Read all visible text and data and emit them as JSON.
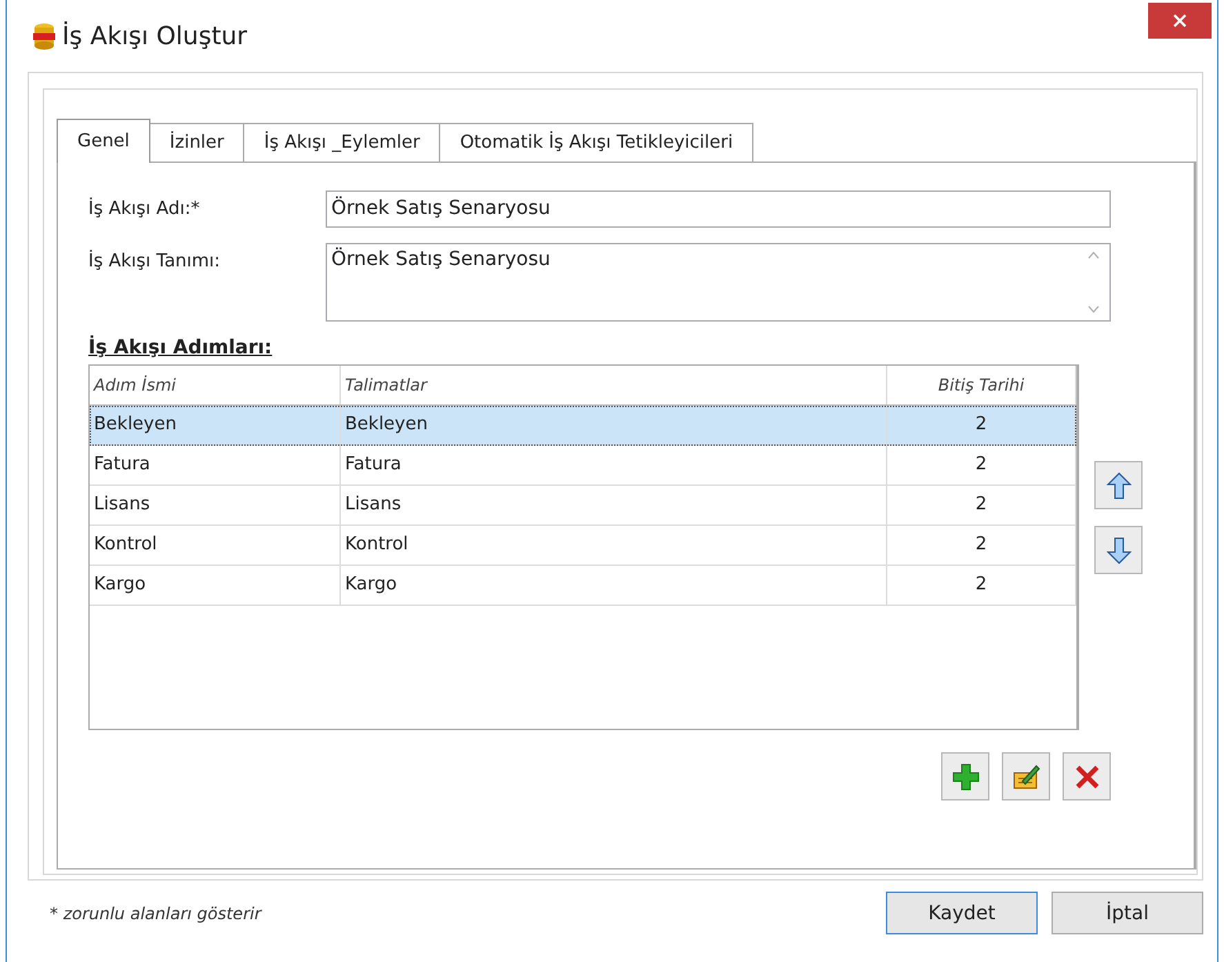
{
  "window": {
    "title": "İş Akışı Oluştur"
  },
  "tabs": [
    {
      "label": "Genel",
      "selected": true
    },
    {
      "label": "İzinler",
      "selected": false
    },
    {
      "label": "İş Akışı _Eylemler",
      "selected": false
    },
    {
      "label": "Otomatik İş Akışı Tetikleyicileri",
      "selected": false
    }
  ],
  "form": {
    "name_label": "İş Akışı Adı:*",
    "name_value": "Örnek Satış Senaryosu",
    "description_label": "İş Akışı Tanımı:",
    "description_value": "Örnek Satış Senaryosu"
  },
  "steps": {
    "heading": "İş Akışı Adımları:",
    "columns": [
      "Adım İsmi",
      "Talimatlar",
      "Bitiş Tarihi"
    ],
    "rows": [
      {
        "cells": [
          "Bekleyen",
          "Bekleyen",
          "2"
        ],
        "selected": true
      },
      {
        "cells": [
          "Fatura",
          "Fatura",
          "2"
        ],
        "selected": false
      },
      {
        "cells": [
          "Lisans",
          "Lisans",
          "2"
        ],
        "selected": false
      },
      {
        "cells": [
          "Kontrol",
          "Kontrol",
          "2"
        ],
        "selected": false
      },
      {
        "cells": [
          "Kargo",
          "Kargo",
          "2"
        ],
        "selected": false
      }
    ]
  },
  "footer": {
    "note": "* zorunlu alanları gösterir",
    "buttons": [
      {
        "label": "Kaydet",
        "selected": true
      },
      {
        "label": "İptal",
        "selected": false
      }
    ]
  }
}
